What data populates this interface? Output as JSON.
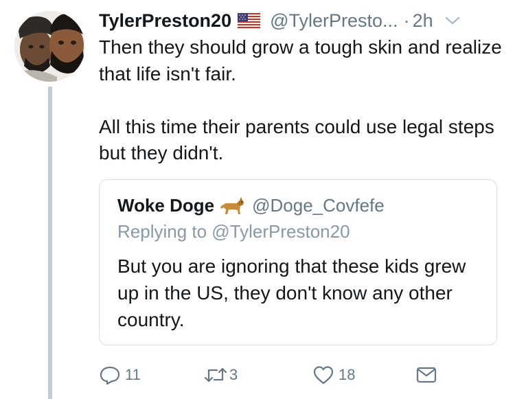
{
  "tweet": {
    "display_name": "TylerPreston20",
    "flag_icon": "us-flag-icon",
    "handle": "@TylerPresto...",
    "separator": "·",
    "time": "2h",
    "text_paragraph_1": "Then they should grow a tough skin and realize that life isn't fair.",
    "text_paragraph_2": "All this time their parents could use legal steps but they didn't."
  },
  "quoted_tweet": {
    "display_name": "Woke Doge",
    "emoji_icon": "dog-icon",
    "handle": "@Doge_Covfefe",
    "replying_to": "Replying to @TylerPreston20",
    "text": "But you are ignoring that these kids grew up in the US, they don't know any other country."
  },
  "actions": {
    "reply_count": "11",
    "retweet_count": "3",
    "like_count": "18",
    "reply_icon": "reply-icon",
    "retweet_icon": "retweet-icon",
    "like_icon": "heart-icon",
    "dm_icon": "envelope-icon"
  },
  "colors": {
    "primary_text": "#14171a",
    "secondary_text": "#657786",
    "reply_text": "#8899a6",
    "border": "#d8dee3",
    "thread_line": "#c4ccd3"
  }
}
